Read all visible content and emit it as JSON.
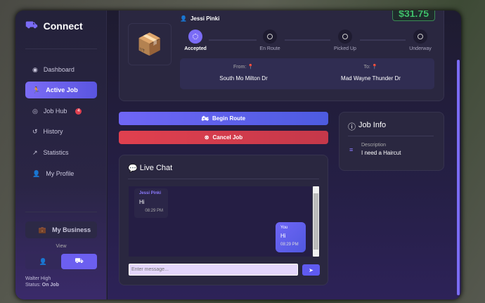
{
  "app": {
    "title": "Connect",
    "icon": "truck-icon"
  },
  "sidebar": {
    "items": [
      {
        "label": "Dashboard",
        "icon": "gauge-icon"
      },
      {
        "label": "Active Job",
        "icon": "running-icon",
        "active": true
      },
      {
        "label": "Job Hub",
        "icon": "compass-icon",
        "badge": "4"
      },
      {
        "label": "History",
        "icon": "history-icon"
      },
      {
        "label": "Statistics",
        "icon": "chart-line-icon"
      },
      {
        "label": "My Profile",
        "icon": "user-gear-icon"
      }
    ],
    "business_label": "My Business",
    "view_label": "View",
    "user_name": "Walter High",
    "status_label": "Status:",
    "status_value": "On Job"
  },
  "job": {
    "price": "$31.75",
    "customer": "Jessi Pinki",
    "steps": [
      "Accepted",
      "En Route",
      "Picked Up",
      "Underway"
    ],
    "current_step": 0,
    "from_label": "From:",
    "from": "South Mo Milton Dr",
    "to_label": "To:",
    "to": "Mad Wayne Thunder Dr"
  },
  "actions": {
    "begin": "Begin Route",
    "cancel": "Cancel Job"
  },
  "info": {
    "title": "Job Info",
    "desc_label": "Description",
    "desc": "I need a Haircut"
  },
  "chat": {
    "title": "Live Chat",
    "placeholder": "Enter message...",
    "messages": [
      {
        "sender": "Jessi Pinki",
        "text": "Hi",
        "time": "08:29 PM"
      },
      {
        "sender": "You",
        "text": "Hi",
        "time": "08:29 PM"
      }
    ]
  },
  "colors": {
    "accent": "#6c63f0",
    "danger": "#d9404d",
    "price": "#3fbf6a"
  }
}
